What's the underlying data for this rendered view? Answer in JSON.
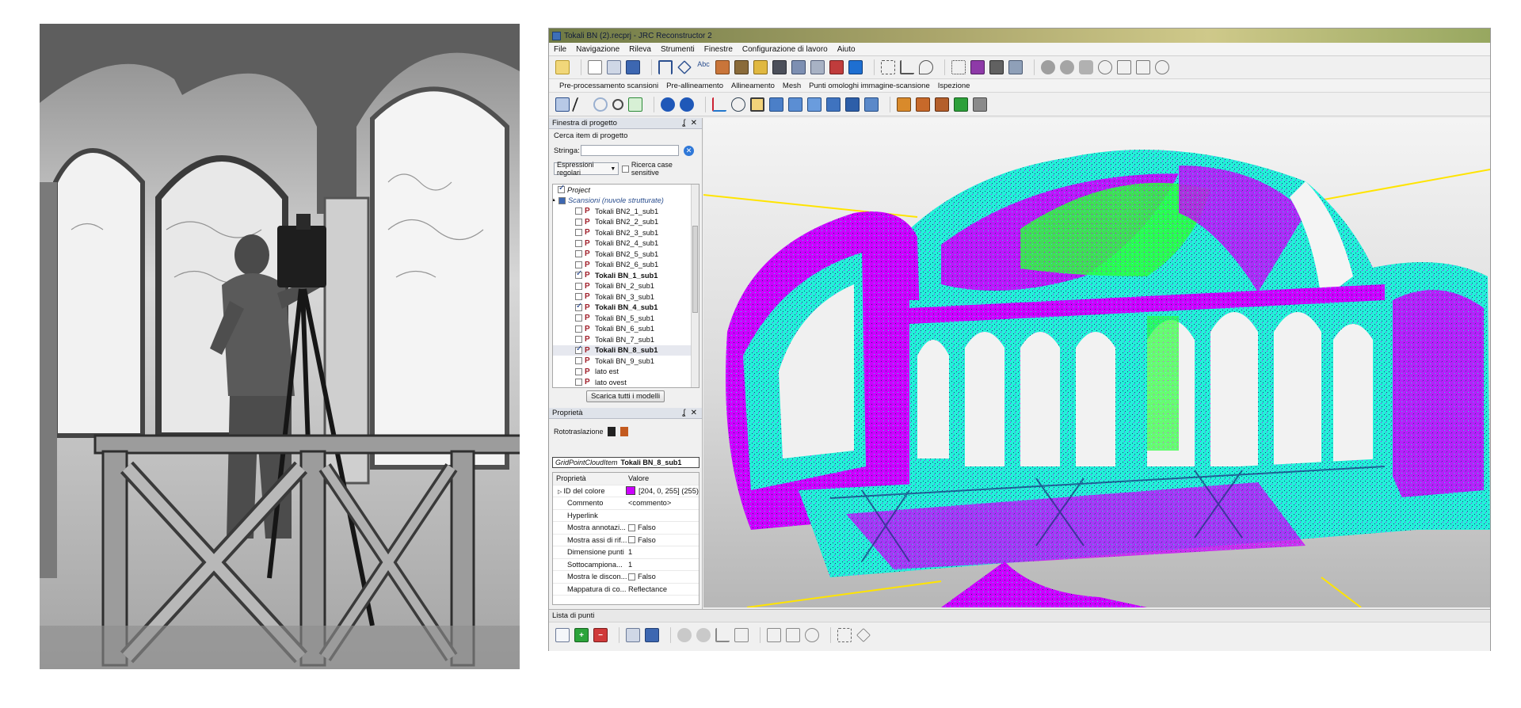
{
  "window": {
    "title": "Tokali BN (2).recprj - JRC Reconstructor 2"
  },
  "menu": [
    "File",
    "Navigazione",
    "Rileva",
    "Strumenti",
    "Finestre",
    "Configurazione di lavoro",
    "Aiuto"
  ],
  "workflow_tabs": [
    "Pre-processamento scansioni",
    "Pre-allineamento",
    "Allineamento",
    "Mesh",
    "Punti omologhi immagine-scansione",
    "Ispezione"
  ],
  "project_panel": {
    "title": "Finestra di progetto",
    "controls": "ʆ ✕",
    "search_heading": "Cerca item di progetto",
    "string_label": "Stringa:",
    "regex_select": "Espressioni regolari",
    "case_label": "Ricerca case sensitive",
    "tree": [
      {
        "label": "Project",
        "level": 0,
        "checked": true,
        "italic": true,
        "bold": false,
        "icon": ""
      },
      {
        "label": "Scansioni (nuvole strutturate)",
        "level": 0,
        "checked": false,
        "italic": true,
        "bold": false,
        "icon": ""
      },
      {
        "label": "Tokali BN2_1_sub1",
        "level": 1,
        "checked": false,
        "bold": false,
        "icon": "P"
      },
      {
        "label": "Tokali BN2_2_sub1",
        "level": 1,
        "checked": false,
        "bold": false,
        "icon": "P"
      },
      {
        "label": "Tokali BN2_3_sub1",
        "level": 1,
        "checked": false,
        "bold": false,
        "icon": "P"
      },
      {
        "label": "Tokali BN2_4_sub1",
        "level": 1,
        "checked": false,
        "bold": false,
        "icon": "P"
      },
      {
        "label": "Tokali BN2_5_sub1",
        "level": 1,
        "checked": false,
        "bold": false,
        "icon": "P"
      },
      {
        "label": "Tokali BN2_6_sub1",
        "level": 1,
        "checked": false,
        "bold": false,
        "icon": "P"
      },
      {
        "label": "Tokali BN_1_sub1",
        "level": 1,
        "checked": true,
        "bold": true,
        "icon": "P"
      },
      {
        "label": "Tokali BN_2_sub1",
        "level": 1,
        "checked": false,
        "bold": false,
        "icon": "P"
      },
      {
        "label": "Tokali BN_3_sub1",
        "level": 1,
        "checked": false,
        "bold": false,
        "icon": "P"
      },
      {
        "label": "Tokali BN_4_sub1",
        "level": 1,
        "checked": true,
        "bold": true,
        "icon": "P"
      },
      {
        "label": "Tokali BN_5_sub1",
        "level": 1,
        "checked": false,
        "bold": false,
        "icon": "P"
      },
      {
        "label": "Tokali BN_6_sub1",
        "level": 1,
        "checked": false,
        "bold": false,
        "icon": "P"
      },
      {
        "label": "Tokali BN_7_sub1",
        "level": 1,
        "checked": false,
        "bold": false,
        "icon": "P"
      },
      {
        "label": "Tokali BN_8_sub1",
        "level": 1,
        "checked": true,
        "bold": true,
        "icon": "P",
        "selected": true
      },
      {
        "label": "Tokali BN_9_sub1",
        "level": 1,
        "checked": false,
        "bold": false,
        "icon": "P"
      },
      {
        "label": "lato est",
        "level": 1,
        "checked": false,
        "bold": false,
        "icon": "P"
      },
      {
        "label": "lato ovest",
        "level": 1,
        "checked": false,
        "bold": false,
        "icon": "P"
      }
    ],
    "download_all_button": "Scarica tutti i modelli"
  },
  "properties_panel": {
    "title": "Proprietà",
    "controls": "ʆ ✕",
    "roto_label": "Rototraslazione",
    "item_type": "GridPointCloudItem",
    "item_name": "Tokali BN_8_sub1",
    "col_property": "Proprietà",
    "col_value": "Valore",
    "rows": [
      {
        "key": "ID del colore",
        "value": "[204, 0, 255] (255)",
        "swatch": "#cc00ff",
        "expander": true
      },
      {
        "key": "Commento",
        "value": "<commento>"
      },
      {
        "key": "Hyperlink",
        "value": ""
      },
      {
        "key": "Mostra annotazi...",
        "value": "Falso",
        "checkbox": true
      },
      {
        "key": "Mostra assi di rif...",
        "value": "Falso",
        "checkbox": true
      },
      {
        "key": "Dimensione punti",
        "value": "1"
      },
      {
        "key": "Sottocampiona...",
        "value": "1"
      },
      {
        "key": "Mostra le discon...",
        "value": "Falso",
        "checkbox": true
      },
      {
        "key": "Mappatura di co...",
        "value": "Reflectance"
      }
    ]
  },
  "bottom_panel": {
    "title": "Lista di punti"
  },
  "colors": {
    "cloud_cyan": "#22f2d8",
    "cloud_magenta": "#cc00ff",
    "cloud_green": "#2bff3a",
    "cloud_dark": "#1a2f7a",
    "reference_line": "#ffe400"
  }
}
